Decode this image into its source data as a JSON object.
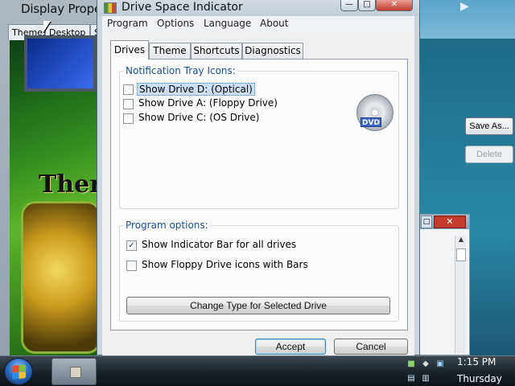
{
  "background_window": {
    "title": "Display Prope",
    "tabs": [
      "Themes",
      "Desktop",
      "S"
    ],
    "preview_text": "Ther"
  },
  "right_window": {
    "save_label": "Save As...",
    "delete_label": "Delete"
  },
  "app": {
    "title": "Drive Space Indicator",
    "window_buttons": {
      "minimize": "—",
      "maximize": "□",
      "close": "✕"
    }
  },
  "menu": [
    "Program",
    "Options",
    "Language",
    "About"
  ],
  "tabs": [
    "Drives",
    "Theme",
    "Shortcuts",
    "Diagnostics"
  ],
  "active_tab": "Drives",
  "notification_group": {
    "legend": "Notification Tray Icons:",
    "items": [
      {
        "label": "Show Drive D: (Optical)",
        "checked": false,
        "selected": true
      },
      {
        "label": "Show Drive A: (Floppy Drive)",
        "checked": false,
        "selected": false
      },
      {
        "label": "Show Drive C: (OS Drive)",
        "checked": false,
        "selected": false
      }
    ],
    "drive_badge": "DVD"
  },
  "program_options": {
    "legend": "Program options:",
    "items": [
      {
        "label": "Show Indicator Bar for all drives",
        "checked": true
      },
      {
        "label": "Show Floppy Drive icons with Bars",
        "checked": false
      }
    ],
    "change_button": "Change Type for Selected Drive"
  },
  "footer": {
    "accept": "Accept",
    "cancel": "Cancel"
  },
  "taskbar": {
    "time": "1:15 PM",
    "day": "Thursday"
  },
  "icons": {
    "checkmark": "✓",
    "scroll_up": "▲",
    "close": "✕",
    "maximize": "□",
    "play": "▶"
  },
  "colors": {
    "legend_text": "#1b4f96",
    "selection": "#cde0f7",
    "close_red": "#c0392b"
  }
}
